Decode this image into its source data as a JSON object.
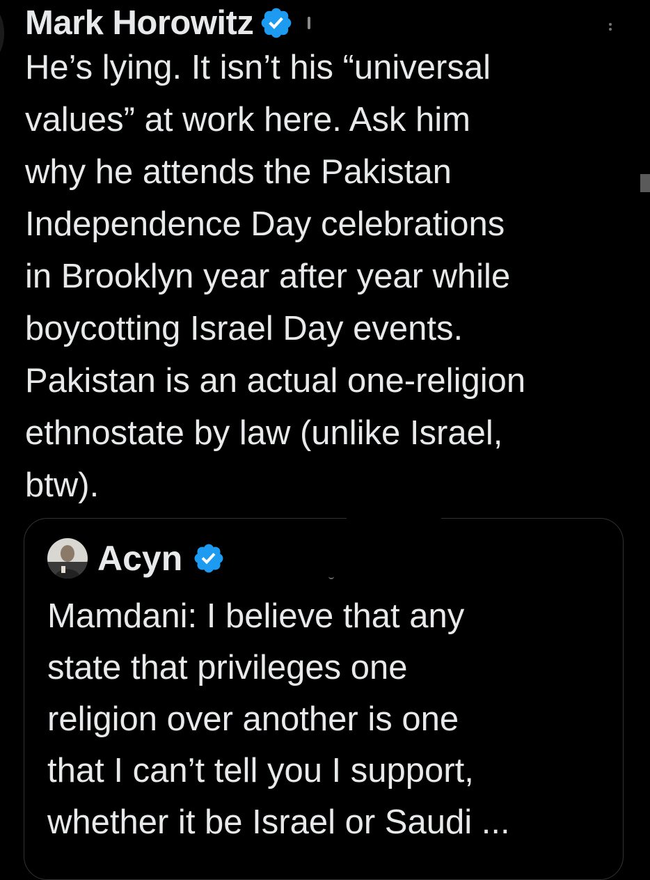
{
  "tweet": {
    "author_name": "Mark Horowitz",
    "text": "He’s lying. It isn’t his “universal\nvalues” at work here. Ask him\nwhy he attends the Pakistan\nIndependence Day celebrations\nin Brooklyn year after year while\nboycotting Israel Day events.\nPakistan is an actual one-religion\nethnostate by law (unlike Israel,\nbtw)."
  },
  "quoted_tweet": {
    "author_name": "Acyn",
    "text": "Mamdani: I believe that any\nstate that privileges one\nreligion over another is one\nthat I can’t tell you I support,\nwhether it be Israel or Saudi ..."
  },
  "icons": {
    "verified": "verified-badge-icon",
    "more": "more-options-icon"
  },
  "colors": {
    "background": "#000000",
    "text": "#e7e9ea",
    "verified": "#1d9bf0",
    "border": "#2f3336"
  }
}
